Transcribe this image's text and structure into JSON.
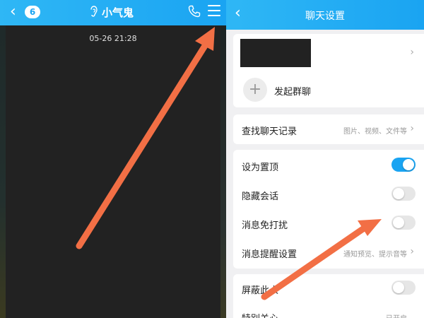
{
  "chat_screen": {
    "unread_count": "6",
    "title": "小气鬼",
    "timestamp": "05-26 21:28"
  },
  "settings_screen": {
    "title": "聊天设置",
    "start_group_label": "发起群聊",
    "search_history": {
      "label": "查找聊天记录",
      "value": "图片、视频、文件等"
    },
    "rows": [
      {
        "label": "设为置顶",
        "toggle": true
      },
      {
        "label": "隐藏会话",
        "toggle": false
      },
      {
        "label": "消息免打扰",
        "toggle": false
      },
      {
        "label": "消息提醒设置",
        "value": "通知预览、提示音等"
      }
    ],
    "rows2": [
      {
        "label": "屏蔽此人",
        "toggle": false
      },
      {
        "label": "特别关心",
        "value": "已开启"
      }
    ]
  },
  "colors": {
    "header_blue": "#1aa4f2",
    "arrow_orange": "#f26f45"
  },
  "icons": [
    "back-icon",
    "ear-icon",
    "phone-icon",
    "menu-icon",
    "chevron-right-icon",
    "plus-icon"
  ]
}
